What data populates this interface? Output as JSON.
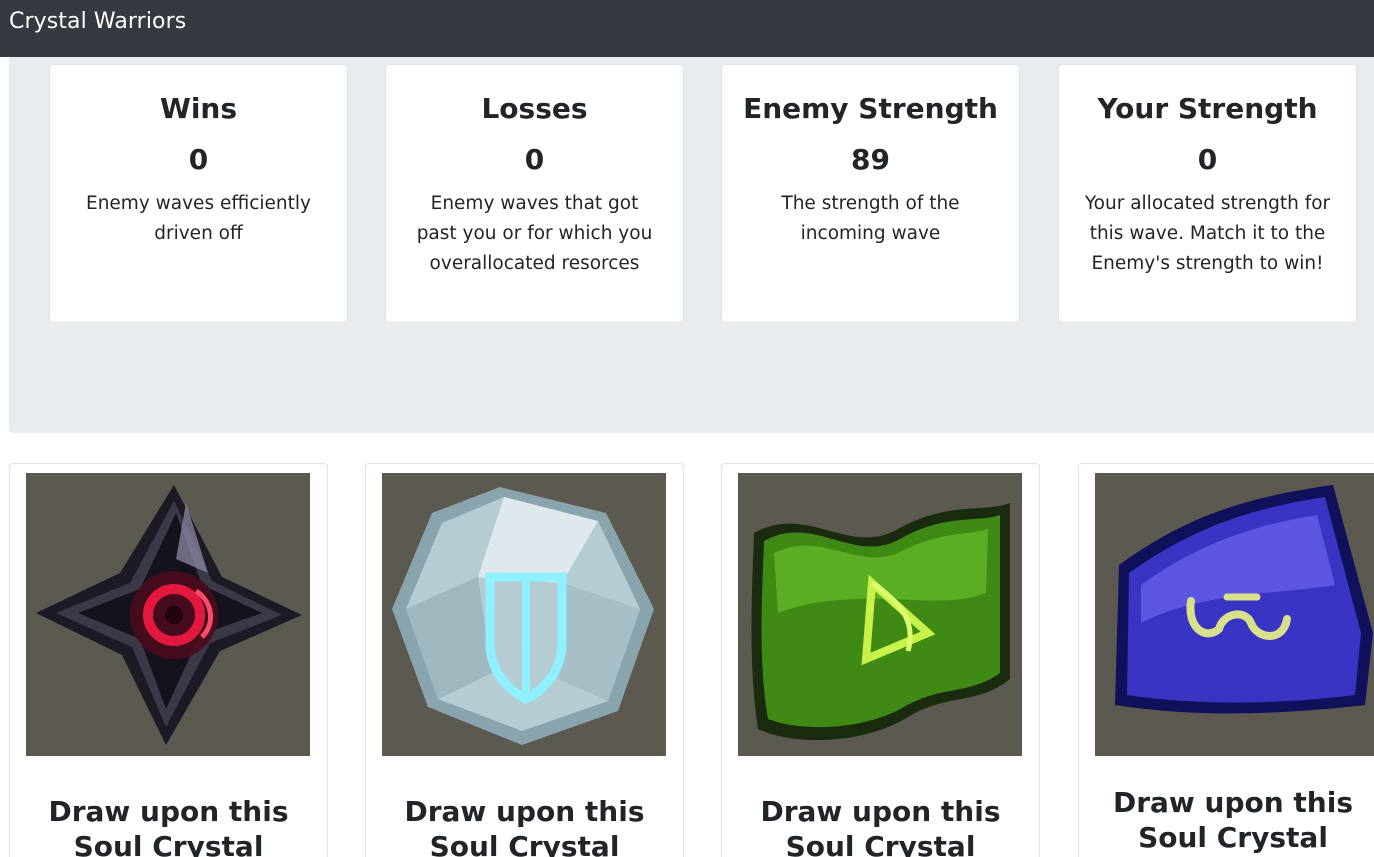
{
  "navbar": {
    "brand": "Crystal Warriors"
  },
  "stats": [
    {
      "title": "Wins",
      "value": "0",
      "description": "Enemy waves efficiently driven off"
    },
    {
      "title": "Losses",
      "value": "0",
      "description": "Enemy waves that got past you or for which you overallocated resorces"
    },
    {
      "title": "Enemy Strength",
      "value": "89",
      "description": "The strength of the incoming wave"
    },
    {
      "title": "Your Strength",
      "value": "0",
      "description": "Your allocated strength for this wave. Match it to the Enemy's strength to win!"
    }
  ],
  "crystals": [
    {
      "caption": "Draw upon this Soul Crystal",
      "icon": "dark-soul-crystal-icon",
      "color": "#d0183a"
    },
    {
      "caption": "Draw upon this Soul Crystal",
      "icon": "shield-soul-crystal-icon",
      "color": "#9fe8f4"
    },
    {
      "caption": "Draw upon this Soul Crystal",
      "icon": "bow-soul-crystal-icon",
      "color": "#4aa81a"
    },
    {
      "caption": "Draw upon this Soul Crystal",
      "icon": "arcane-soul-crystal-icon",
      "color": "#3c36c8"
    }
  ]
}
